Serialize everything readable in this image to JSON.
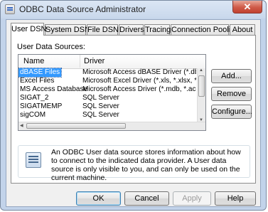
{
  "window": {
    "title": "ODBC Data Source Administrator",
    "close_glyph": "✕"
  },
  "tabs": [
    {
      "label": "User DSN",
      "active": true
    },
    {
      "label": "System DSN"
    },
    {
      "label": "File DSN"
    },
    {
      "label": "Drivers"
    },
    {
      "label": "Tracing"
    },
    {
      "label": "Connection Pooling"
    },
    {
      "label": "About"
    }
  ],
  "user_dsn": {
    "section_label": "User Data Sources:",
    "columns": {
      "name": "Name",
      "driver": "Driver"
    },
    "rows": [
      {
        "name": "dBASE Files",
        "driver": "Microsoft Access dBASE Driver (*.dbf, *.n",
        "selected": true
      },
      {
        "name": "Excel Files",
        "driver": "Microsoft Excel Driver (*.xls, *.xlsx, *.xlsm"
      },
      {
        "name": "MS Access Database",
        "driver": "Microsoft Access Driver (*.mdb, *.accdb)"
      },
      {
        "name": "SIGAT_2",
        "driver": "SQL Server"
      },
      {
        "name": "SIGATMEMP",
        "driver": "SQL Server"
      },
      {
        "name": "sigCOM",
        "driver": "SQL Server"
      }
    ],
    "buttons": {
      "add": "Add...",
      "remove": "Remove",
      "configure": "Configure..."
    },
    "info_text": "An ODBC User data source stores information about how to connect to the indicated data provider.  A User data source is only visible to you, and can only be used on the current machine."
  },
  "footer": {
    "ok": "OK",
    "cancel": "Cancel",
    "apply": "Apply",
    "help": "Help"
  }
}
